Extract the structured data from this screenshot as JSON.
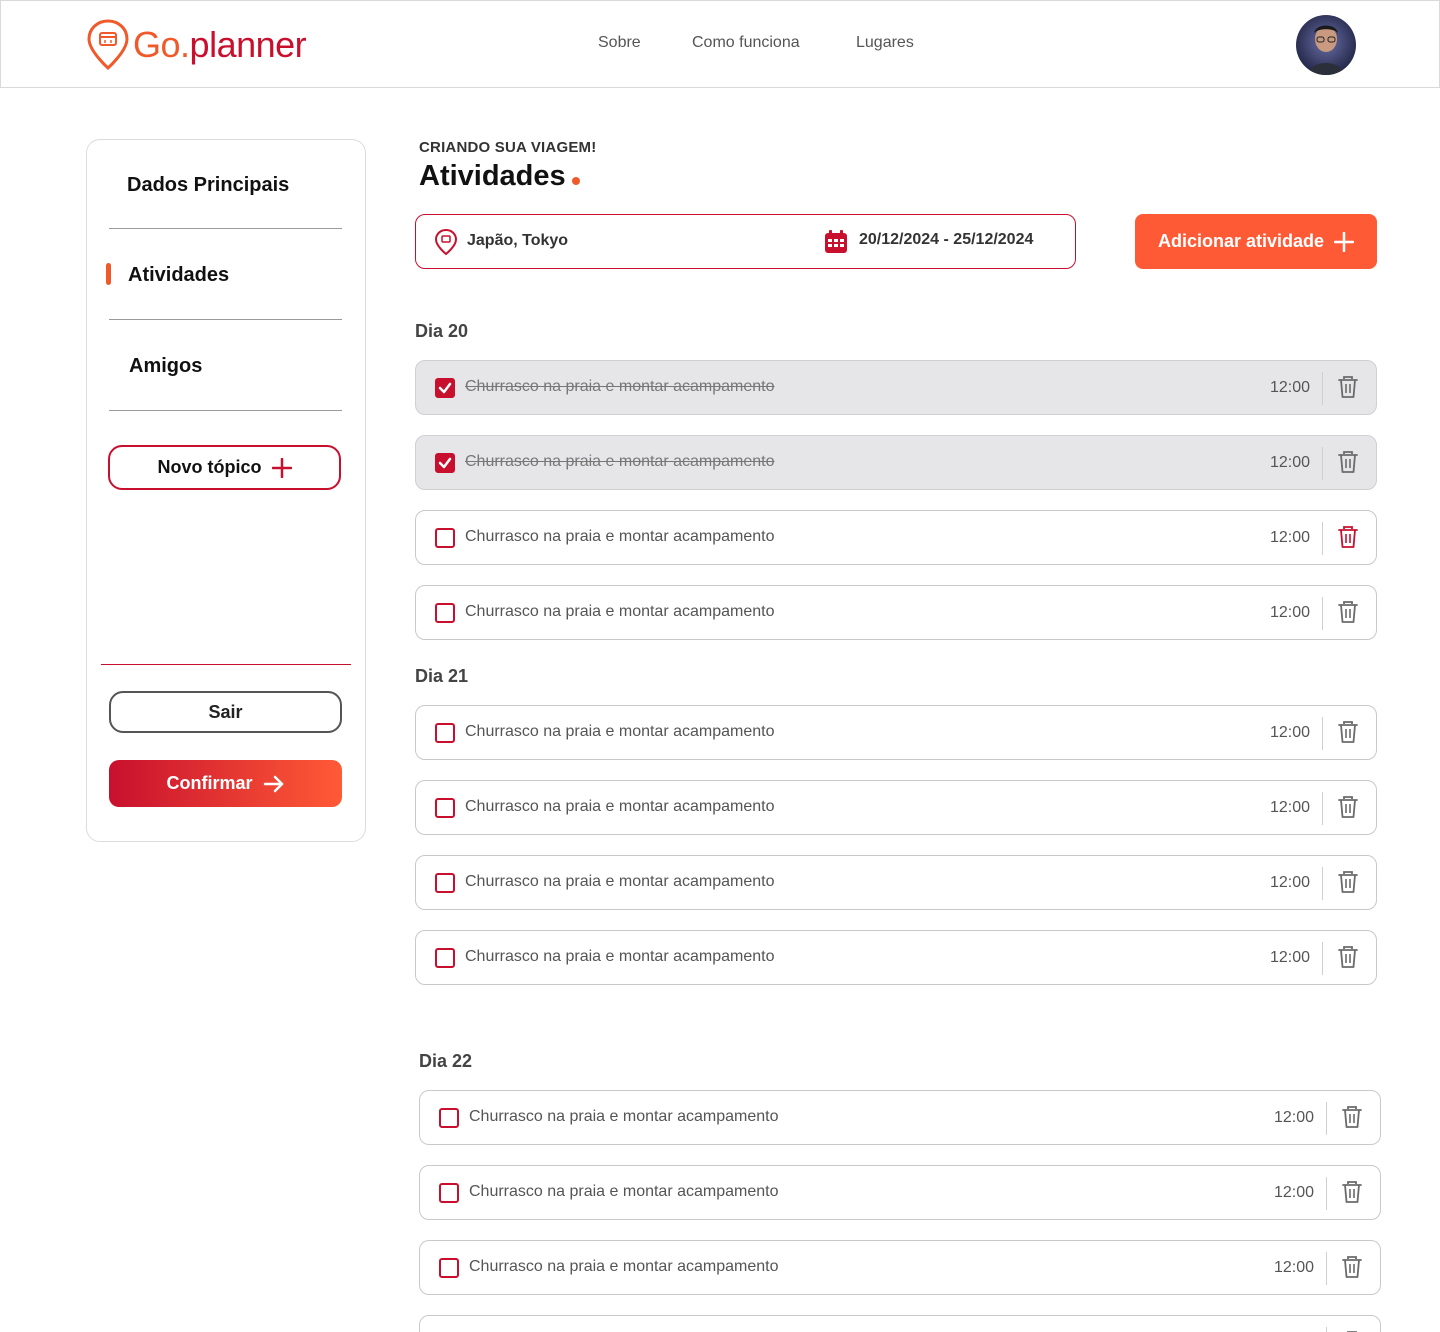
{
  "brand": {
    "go": "Go",
    "dot": ".",
    "planner": "planner"
  },
  "nav": [
    "Sobre",
    "Como funciona",
    "Lugares"
  ],
  "sidebar": {
    "items": [
      {
        "label": "Dados Principais",
        "active": false
      },
      {
        "label": "Atividades",
        "active": true
      },
      {
        "label": "Amigos",
        "active": false
      }
    ],
    "new_topic": "Novo tópico",
    "exit": "Sair",
    "confirm": "Confirmar"
  },
  "main": {
    "eyebrow": "CRIANDO SUA VIAGEM!",
    "title": "Atividades",
    "location": "Japão, Tokyo",
    "dates": "20/12/2024 - 25/12/2024",
    "add_button": "Adicionar atividade"
  },
  "days": [
    {
      "label": "Dia 20",
      "activities": [
        {
          "text": "Churrasco na praia e montar acampamento ",
          "time": "12:00",
          "done": true,
          "trash_highlight": false
        },
        {
          "text": "Churrasco na praia e montar acampamento ",
          "time": "12:00",
          "done": true,
          "trash_highlight": false
        },
        {
          "text": "Churrasco na praia e montar acampamento",
          "time": "12:00",
          "done": false,
          "trash_highlight": true
        },
        {
          "text": "Churrasco na praia e montar acampamento",
          "time": "12:00",
          "done": false,
          "trash_highlight": false
        }
      ]
    },
    {
      "label": "Dia 21",
      "activities": [
        {
          "text": "Churrasco na praia e montar acampamento",
          "time": "12:00",
          "done": false,
          "trash_highlight": false
        },
        {
          "text": "Churrasco na praia e montar acampamento",
          "time": "12:00",
          "done": false,
          "trash_highlight": false
        },
        {
          "text": "Churrasco na praia e montar acampamento",
          "time": "12:00",
          "done": false,
          "trash_highlight": false
        },
        {
          "text": "Churrasco na praia e montar acampamento",
          "time": "12:00",
          "done": false,
          "trash_highlight": false
        }
      ]
    },
    {
      "label": "Dia 22",
      "activities": [
        {
          "text": "Churrasco na praia e montar acampamento",
          "time": "12:00",
          "done": false,
          "trash_highlight": false
        },
        {
          "text": "Churrasco na praia e montar acampamento",
          "time": "12:00",
          "done": false,
          "trash_highlight": false
        },
        {
          "text": "Churrasco na praia e montar acampamento",
          "time": "12:00",
          "done": false,
          "trash_highlight": false
        },
        {
          "text": "",
          "time": "",
          "done": false,
          "trash_highlight": false
        }
      ]
    }
  ],
  "colors": {
    "brand_red": "#c8102e",
    "brand_orange": "#ff5a36",
    "done_row_bg": "#e6e6e8"
  }
}
